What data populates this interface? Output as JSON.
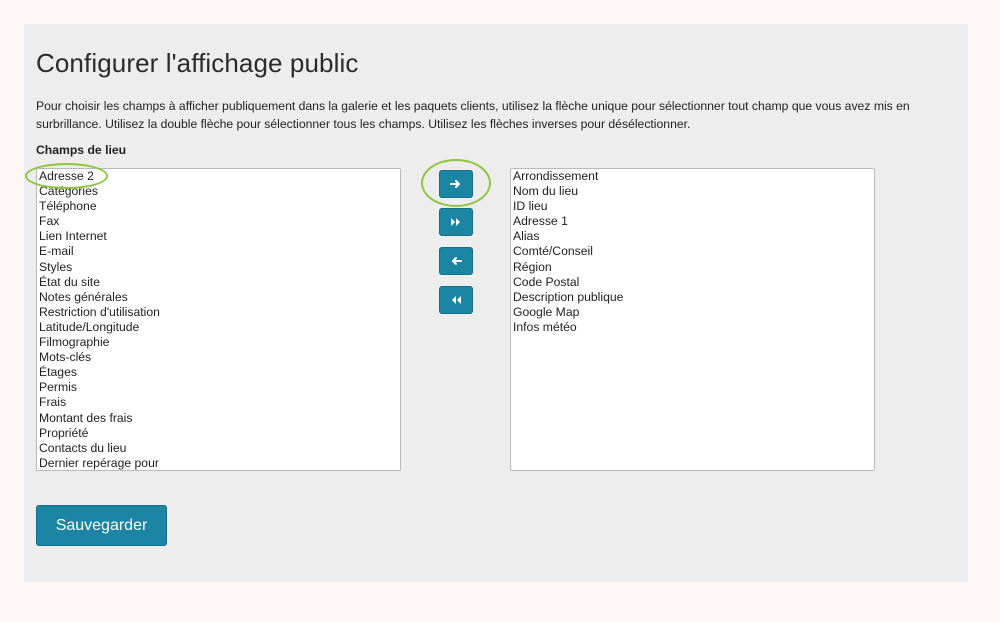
{
  "page": {
    "title": "Configurer l'affichage public",
    "description": "Pour choisir les champs à afficher publiquement dans la galerie et les paquets clients, utilisez la flèche unique pour sélectionner tout champ que vous avez mis en surbrillance. Utilisez la double flèche pour sélectionner tous les champs. Utilisez les flèches inverses pour désélectionner.",
    "section_label": "Champs de lieu"
  },
  "available_fields": [
    "Adresse 2",
    "Catégories",
    "Téléphone",
    "Fax",
    "Lien Internet",
    "E-mail",
    "Styles",
    "État du site",
    "Notes générales",
    "Restriction d'utilisation",
    "Latitude/Longitude",
    "Filmographie",
    "Mots-clés",
    "Étages",
    "Permis",
    "Frais",
    "Montant des frais",
    "Propriété",
    "Contacts du lieu",
    "Dernier repérage pour"
  ],
  "selected_fields": [
    "Arrondissement",
    "Nom du lieu",
    "ID lieu",
    "Adresse 1",
    "Alias",
    "Comté/Conseil",
    "Région",
    "Code Postal",
    "Description publique",
    "Google Map",
    "Infos météo"
  ],
  "buttons": {
    "move_right_icon": "arrow-right-icon",
    "move_all_right_icon": "double-chevron-right-icon",
    "move_left_icon": "arrow-left-icon",
    "move_all_left_icon": "double-chevron-left-icon",
    "save_label": "Sauvegarder"
  },
  "colors": {
    "primary_button": "#1a86a4",
    "highlight_annotation": "#8cc63f",
    "panel_background": "#ededed"
  }
}
